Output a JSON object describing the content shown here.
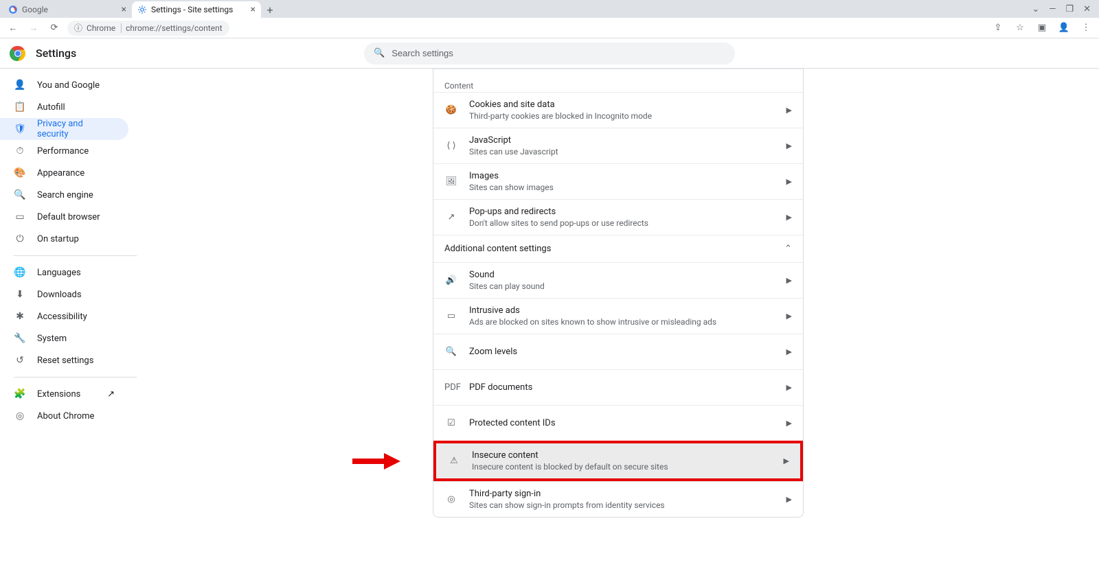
{
  "tabs": [
    {
      "title": "Google",
      "active": false
    },
    {
      "title": "Settings - Site settings",
      "active": true
    }
  ],
  "toolbar": {
    "site_label": "Chrome",
    "url": "chrome://settings/content"
  },
  "header": {
    "title": "Settings"
  },
  "search": {
    "placeholder": "Search settings"
  },
  "sidebar": {
    "groups": [
      {
        "items": [
          {
            "id": "you-and-google",
            "label": "You and Google",
            "glyph": "👤"
          },
          {
            "id": "autofill",
            "label": "Autofill",
            "glyph": "📋"
          },
          {
            "id": "privacy",
            "label": "Privacy and security",
            "glyph": "🛡",
            "active": true
          },
          {
            "id": "performance",
            "label": "Performance",
            "glyph": "⏱"
          },
          {
            "id": "appearance",
            "label": "Appearance",
            "glyph": "🎨"
          },
          {
            "id": "search-engine",
            "label": "Search engine",
            "glyph": "🔍"
          },
          {
            "id": "default-browser",
            "label": "Default browser",
            "glyph": "▭"
          },
          {
            "id": "on-startup",
            "label": "On startup",
            "glyph": "⏻"
          }
        ]
      },
      {
        "items": [
          {
            "id": "languages",
            "label": "Languages",
            "glyph": "🌐"
          },
          {
            "id": "downloads",
            "label": "Downloads",
            "glyph": "⬇"
          },
          {
            "id": "accessibility",
            "label": "Accessibility",
            "glyph": "✱"
          },
          {
            "id": "system",
            "label": "System",
            "glyph": "🔧"
          },
          {
            "id": "reset",
            "label": "Reset settings",
            "glyph": "↺"
          }
        ]
      },
      {
        "items": [
          {
            "id": "extensions",
            "label": "Extensions",
            "glyph": "🧩",
            "external": true
          },
          {
            "id": "about",
            "label": "About Chrome",
            "glyph": "◎"
          }
        ]
      }
    ]
  },
  "content": {
    "section_label": "Content",
    "items": [
      {
        "id": "cookies",
        "icon": "🍪",
        "title": "Cookies and site data",
        "sub": "Third-party cookies are blocked in Incognito mode"
      },
      {
        "id": "javascript",
        "icon": "⟨ ⟩",
        "title": "JavaScript",
        "sub": "Sites can use Javascript"
      },
      {
        "id": "images",
        "icon": "🖼",
        "title": "Images",
        "sub": "Sites can show images"
      },
      {
        "id": "popups",
        "icon": "↗",
        "title": "Pop-ups and redirects",
        "sub": "Don't allow sites to send pop-ups or use redirects"
      }
    ],
    "expander": {
      "label": "Additional content settings",
      "expanded": true
    },
    "additional": [
      {
        "id": "sound",
        "icon": "🔊",
        "title": "Sound",
        "sub": "Sites can play sound"
      },
      {
        "id": "ads",
        "icon": "▭",
        "title": "Intrusive ads",
        "sub": "Ads are blocked on sites known to show intrusive or misleading ads"
      },
      {
        "id": "zoom",
        "icon": "🔍",
        "title": "Zoom levels",
        "sub": ""
      },
      {
        "id": "pdf",
        "icon": "PDF",
        "title": "PDF documents",
        "sub": ""
      },
      {
        "id": "protected",
        "icon": "☑",
        "title": "Protected content IDs",
        "sub": ""
      },
      {
        "id": "insecure",
        "icon": "⚠",
        "title": "Insecure content",
        "sub": "Insecure content is blocked by default on secure sites",
        "highlighted": true
      },
      {
        "id": "fedid",
        "icon": "◎",
        "title": "Third-party sign-in",
        "sub": "Sites can show sign-in prompts from identity services"
      }
    ]
  },
  "annotation": {
    "arrow_target": "insecure"
  }
}
